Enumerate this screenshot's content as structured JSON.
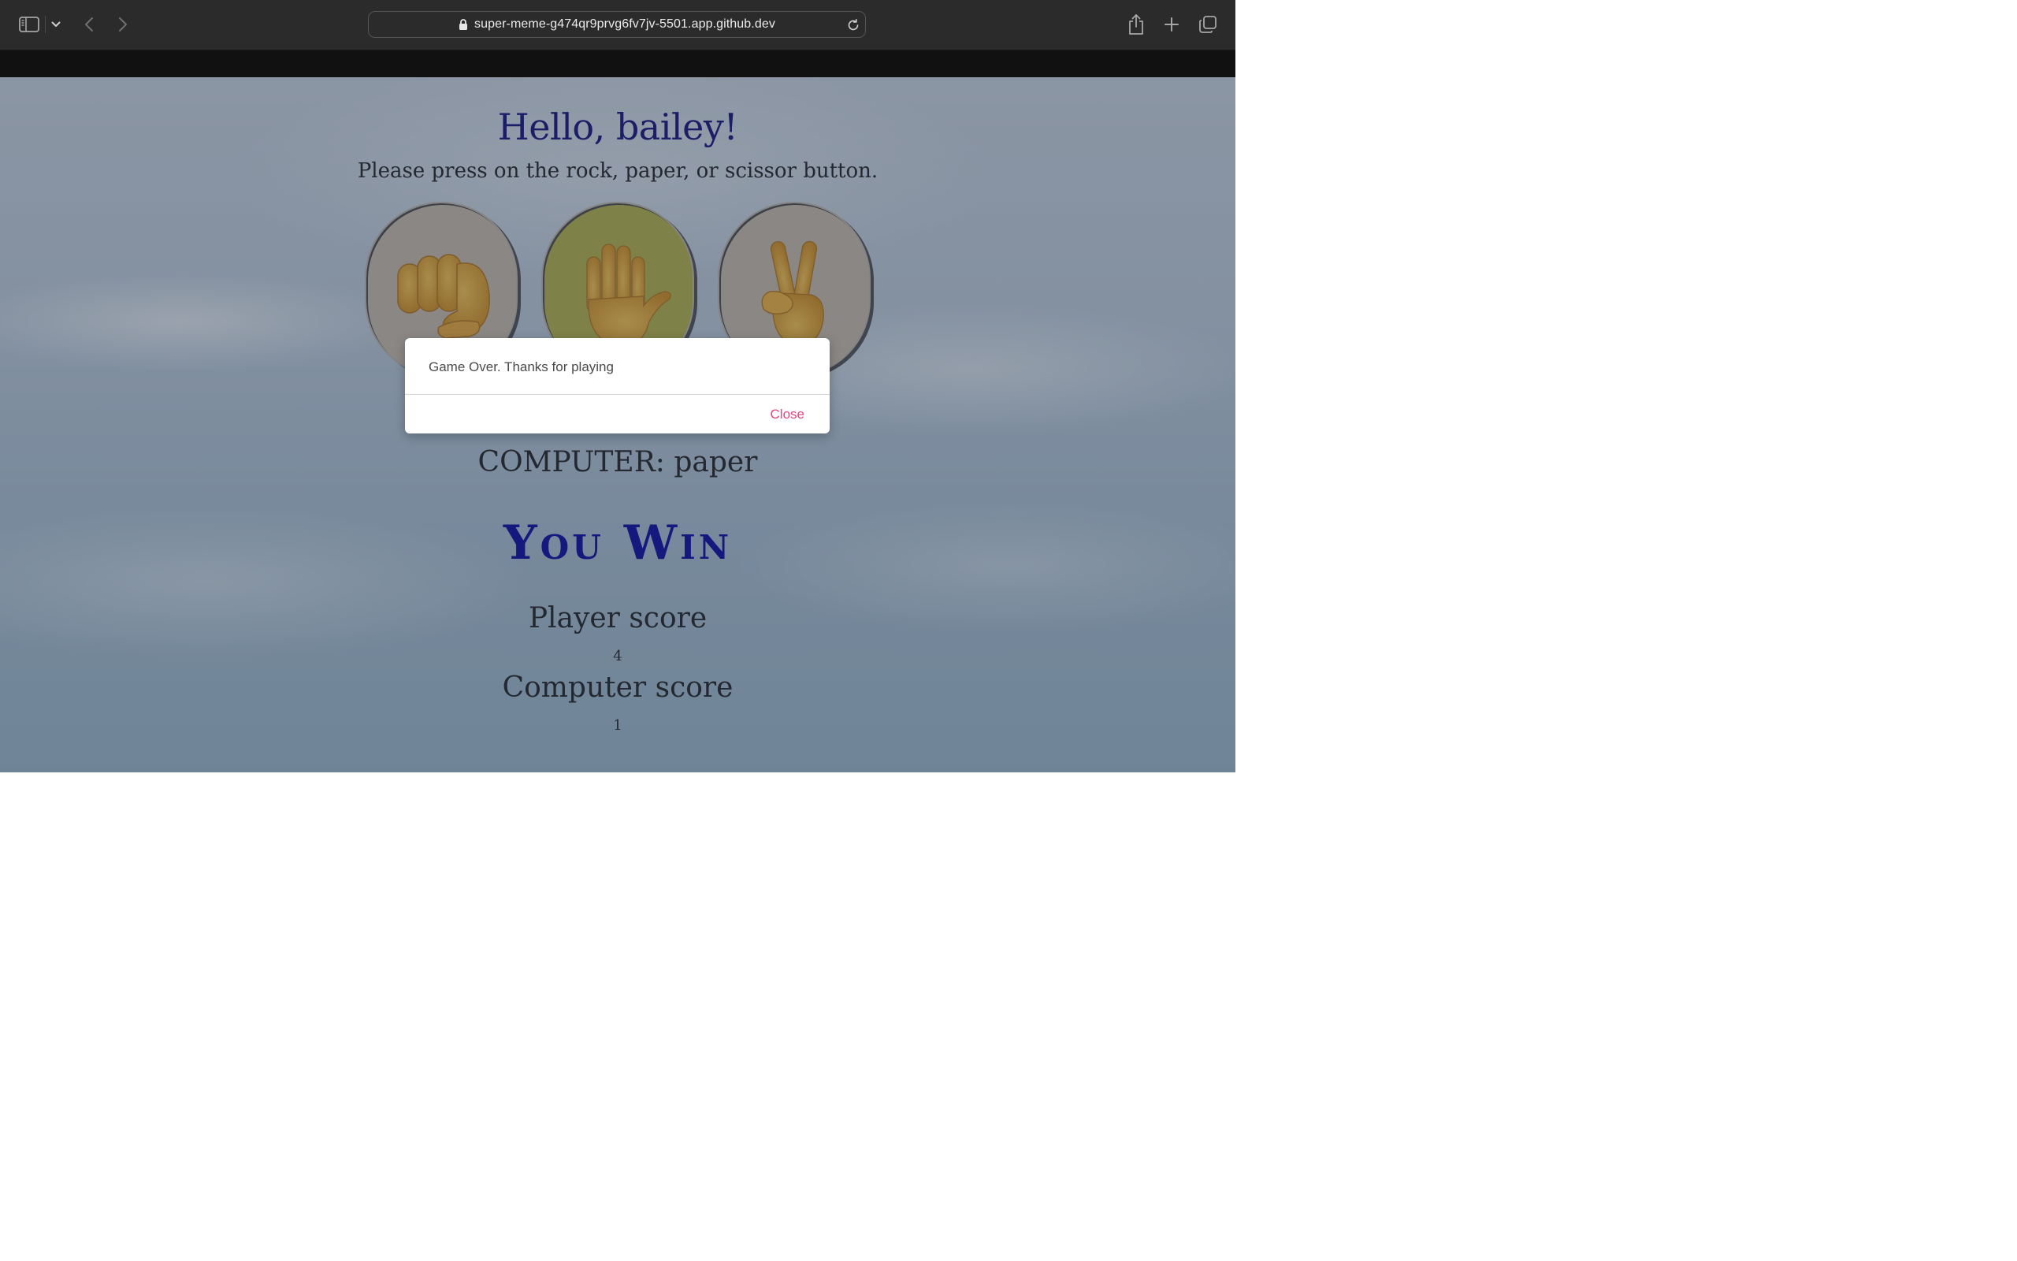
{
  "browser": {
    "url": "super-meme-g474qr9prvg6fv7jv-5501.app.github.dev",
    "icons": {
      "sidebar": "sidebar-icon",
      "sidebar_menu": "chevron-down-icon",
      "back": "chevron-left-icon",
      "forward": "chevron-right-icon",
      "lock": "lock-icon",
      "reload": "reload-icon",
      "share": "share-icon",
      "new_tab": "plus-icon",
      "tab_overview": "tabs-icon"
    }
  },
  "game": {
    "greeting": "Hello, bailey!",
    "instructions": "Please press on the rock, paper, or scissor button.",
    "choices": [
      {
        "name": "rock",
        "icon": "fist-icon",
        "selected": false,
        "color": "#c8bcaa"
      },
      {
        "name": "paper",
        "icon": "raised-hand-icon",
        "selected": true,
        "color": "#b3b44a"
      },
      {
        "name": "scissors",
        "icon": "victory-hand-icon",
        "selected": false,
        "color": "#c8bcaa"
      }
    ],
    "computer_choice": "COMPUTER: paper",
    "result": "You Win",
    "player_score_label": "Player score",
    "player_score": "4",
    "computer_score_label": "Computer score",
    "computer_score": "1"
  },
  "modal": {
    "message": "Game Over. Thanks for playing",
    "close_label": "Close",
    "accent_color": "#e2437f"
  },
  "colors": {
    "greeting": "#14127a",
    "result": "#0a0a9e"
  }
}
